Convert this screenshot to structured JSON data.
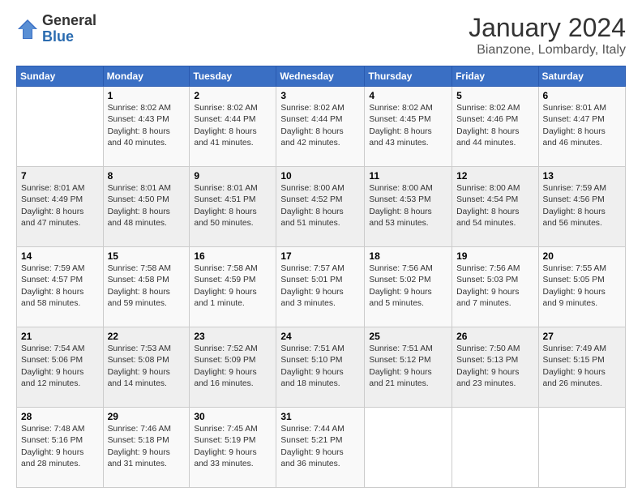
{
  "logo": {
    "general": "General",
    "blue": "Blue"
  },
  "title": "January 2024",
  "location": "Bianzone, Lombardy, Italy",
  "days_of_week": [
    "Sunday",
    "Monday",
    "Tuesday",
    "Wednesday",
    "Thursday",
    "Friday",
    "Saturday"
  ],
  "weeks": [
    [
      {
        "day": "",
        "sunrise": "",
        "sunset": "",
        "daylight": ""
      },
      {
        "day": "1",
        "sunrise": "Sunrise: 8:02 AM",
        "sunset": "Sunset: 4:43 PM",
        "daylight": "Daylight: 8 hours and 40 minutes."
      },
      {
        "day": "2",
        "sunrise": "Sunrise: 8:02 AM",
        "sunset": "Sunset: 4:44 PM",
        "daylight": "Daylight: 8 hours and 41 minutes."
      },
      {
        "day": "3",
        "sunrise": "Sunrise: 8:02 AM",
        "sunset": "Sunset: 4:44 PM",
        "daylight": "Daylight: 8 hours and 42 minutes."
      },
      {
        "day": "4",
        "sunrise": "Sunrise: 8:02 AM",
        "sunset": "Sunset: 4:45 PM",
        "daylight": "Daylight: 8 hours and 43 minutes."
      },
      {
        "day": "5",
        "sunrise": "Sunrise: 8:02 AM",
        "sunset": "Sunset: 4:46 PM",
        "daylight": "Daylight: 8 hours and 44 minutes."
      },
      {
        "day": "6",
        "sunrise": "Sunrise: 8:01 AM",
        "sunset": "Sunset: 4:47 PM",
        "daylight": "Daylight: 8 hours and 46 minutes."
      }
    ],
    [
      {
        "day": "7",
        "sunrise": "Sunrise: 8:01 AM",
        "sunset": "Sunset: 4:49 PM",
        "daylight": "Daylight: 8 hours and 47 minutes."
      },
      {
        "day": "8",
        "sunrise": "Sunrise: 8:01 AM",
        "sunset": "Sunset: 4:50 PM",
        "daylight": "Daylight: 8 hours and 48 minutes."
      },
      {
        "day": "9",
        "sunrise": "Sunrise: 8:01 AM",
        "sunset": "Sunset: 4:51 PM",
        "daylight": "Daylight: 8 hours and 50 minutes."
      },
      {
        "day": "10",
        "sunrise": "Sunrise: 8:00 AM",
        "sunset": "Sunset: 4:52 PM",
        "daylight": "Daylight: 8 hours and 51 minutes."
      },
      {
        "day": "11",
        "sunrise": "Sunrise: 8:00 AM",
        "sunset": "Sunset: 4:53 PM",
        "daylight": "Daylight: 8 hours and 53 minutes."
      },
      {
        "day": "12",
        "sunrise": "Sunrise: 8:00 AM",
        "sunset": "Sunset: 4:54 PM",
        "daylight": "Daylight: 8 hours and 54 minutes."
      },
      {
        "day": "13",
        "sunrise": "Sunrise: 7:59 AM",
        "sunset": "Sunset: 4:56 PM",
        "daylight": "Daylight: 8 hours and 56 minutes."
      }
    ],
    [
      {
        "day": "14",
        "sunrise": "Sunrise: 7:59 AM",
        "sunset": "Sunset: 4:57 PM",
        "daylight": "Daylight: 8 hours and 58 minutes."
      },
      {
        "day": "15",
        "sunrise": "Sunrise: 7:58 AM",
        "sunset": "Sunset: 4:58 PM",
        "daylight": "Daylight: 8 hours and 59 minutes."
      },
      {
        "day": "16",
        "sunrise": "Sunrise: 7:58 AM",
        "sunset": "Sunset: 4:59 PM",
        "daylight": "Daylight: 9 hours and 1 minute."
      },
      {
        "day": "17",
        "sunrise": "Sunrise: 7:57 AM",
        "sunset": "Sunset: 5:01 PM",
        "daylight": "Daylight: 9 hours and 3 minutes."
      },
      {
        "day": "18",
        "sunrise": "Sunrise: 7:56 AM",
        "sunset": "Sunset: 5:02 PM",
        "daylight": "Daylight: 9 hours and 5 minutes."
      },
      {
        "day": "19",
        "sunrise": "Sunrise: 7:56 AM",
        "sunset": "Sunset: 5:03 PM",
        "daylight": "Daylight: 9 hours and 7 minutes."
      },
      {
        "day": "20",
        "sunrise": "Sunrise: 7:55 AM",
        "sunset": "Sunset: 5:05 PM",
        "daylight": "Daylight: 9 hours and 9 minutes."
      }
    ],
    [
      {
        "day": "21",
        "sunrise": "Sunrise: 7:54 AM",
        "sunset": "Sunset: 5:06 PM",
        "daylight": "Daylight: 9 hours and 12 minutes."
      },
      {
        "day": "22",
        "sunrise": "Sunrise: 7:53 AM",
        "sunset": "Sunset: 5:08 PM",
        "daylight": "Daylight: 9 hours and 14 minutes."
      },
      {
        "day": "23",
        "sunrise": "Sunrise: 7:52 AM",
        "sunset": "Sunset: 5:09 PM",
        "daylight": "Daylight: 9 hours and 16 minutes."
      },
      {
        "day": "24",
        "sunrise": "Sunrise: 7:51 AM",
        "sunset": "Sunset: 5:10 PM",
        "daylight": "Daylight: 9 hours and 18 minutes."
      },
      {
        "day": "25",
        "sunrise": "Sunrise: 7:51 AM",
        "sunset": "Sunset: 5:12 PM",
        "daylight": "Daylight: 9 hours and 21 minutes."
      },
      {
        "day": "26",
        "sunrise": "Sunrise: 7:50 AM",
        "sunset": "Sunset: 5:13 PM",
        "daylight": "Daylight: 9 hours and 23 minutes."
      },
      {
        "day": "27",
        "sunrise": "Sunrise: 7:49 AM",
        "sunset": "Sunset: 5:15 PM",
        "daylight": "Daylight: 9 hours and 26 minutes."
      }
    ],
    [
      {
        "day": "28",
        "sunrise": "Sunrise: 7:48 AM",
        "sunset": "Sunset: 5:16 PM",
        "daylight": "Daylight: 9 hours and 28 minutes."
      },
      {
        "day": "29",
        "sunrise": "Sunrise: 7:46 AM",
        "sunset": "Sunset: 5:18 PM",
        "daylight": "Daylight: 9 hours and 31 minutes."
      },
      {
        "day": "30",
        "sunrise": "Sunrise: 7:45 AM",
        "sunset": "Sunset: 5:19 PM",
        "daylight": "Daylight: 9 hours and 33 minutes."
      },
      {
        "day": "31",
        "sunrise": "Sunrise: 7:44 AM",
        "sunset": "Sunset: 5:21 PM",
        "daylight": "Daylight: 9 hours and 36 minutes."
      },
      {
        "day": "",
        "sunrise": "",
        "sunset": "",
        "daylight": ""
      },
      {
        "day": "",
        "sunrise": "",
        "sunset": "",
        "daylight": ""
      },
      {
        "day": "",
        "sunrise": "",
        "sunset": "",
        "daylight": ""
      }
    ]
  ]
}
